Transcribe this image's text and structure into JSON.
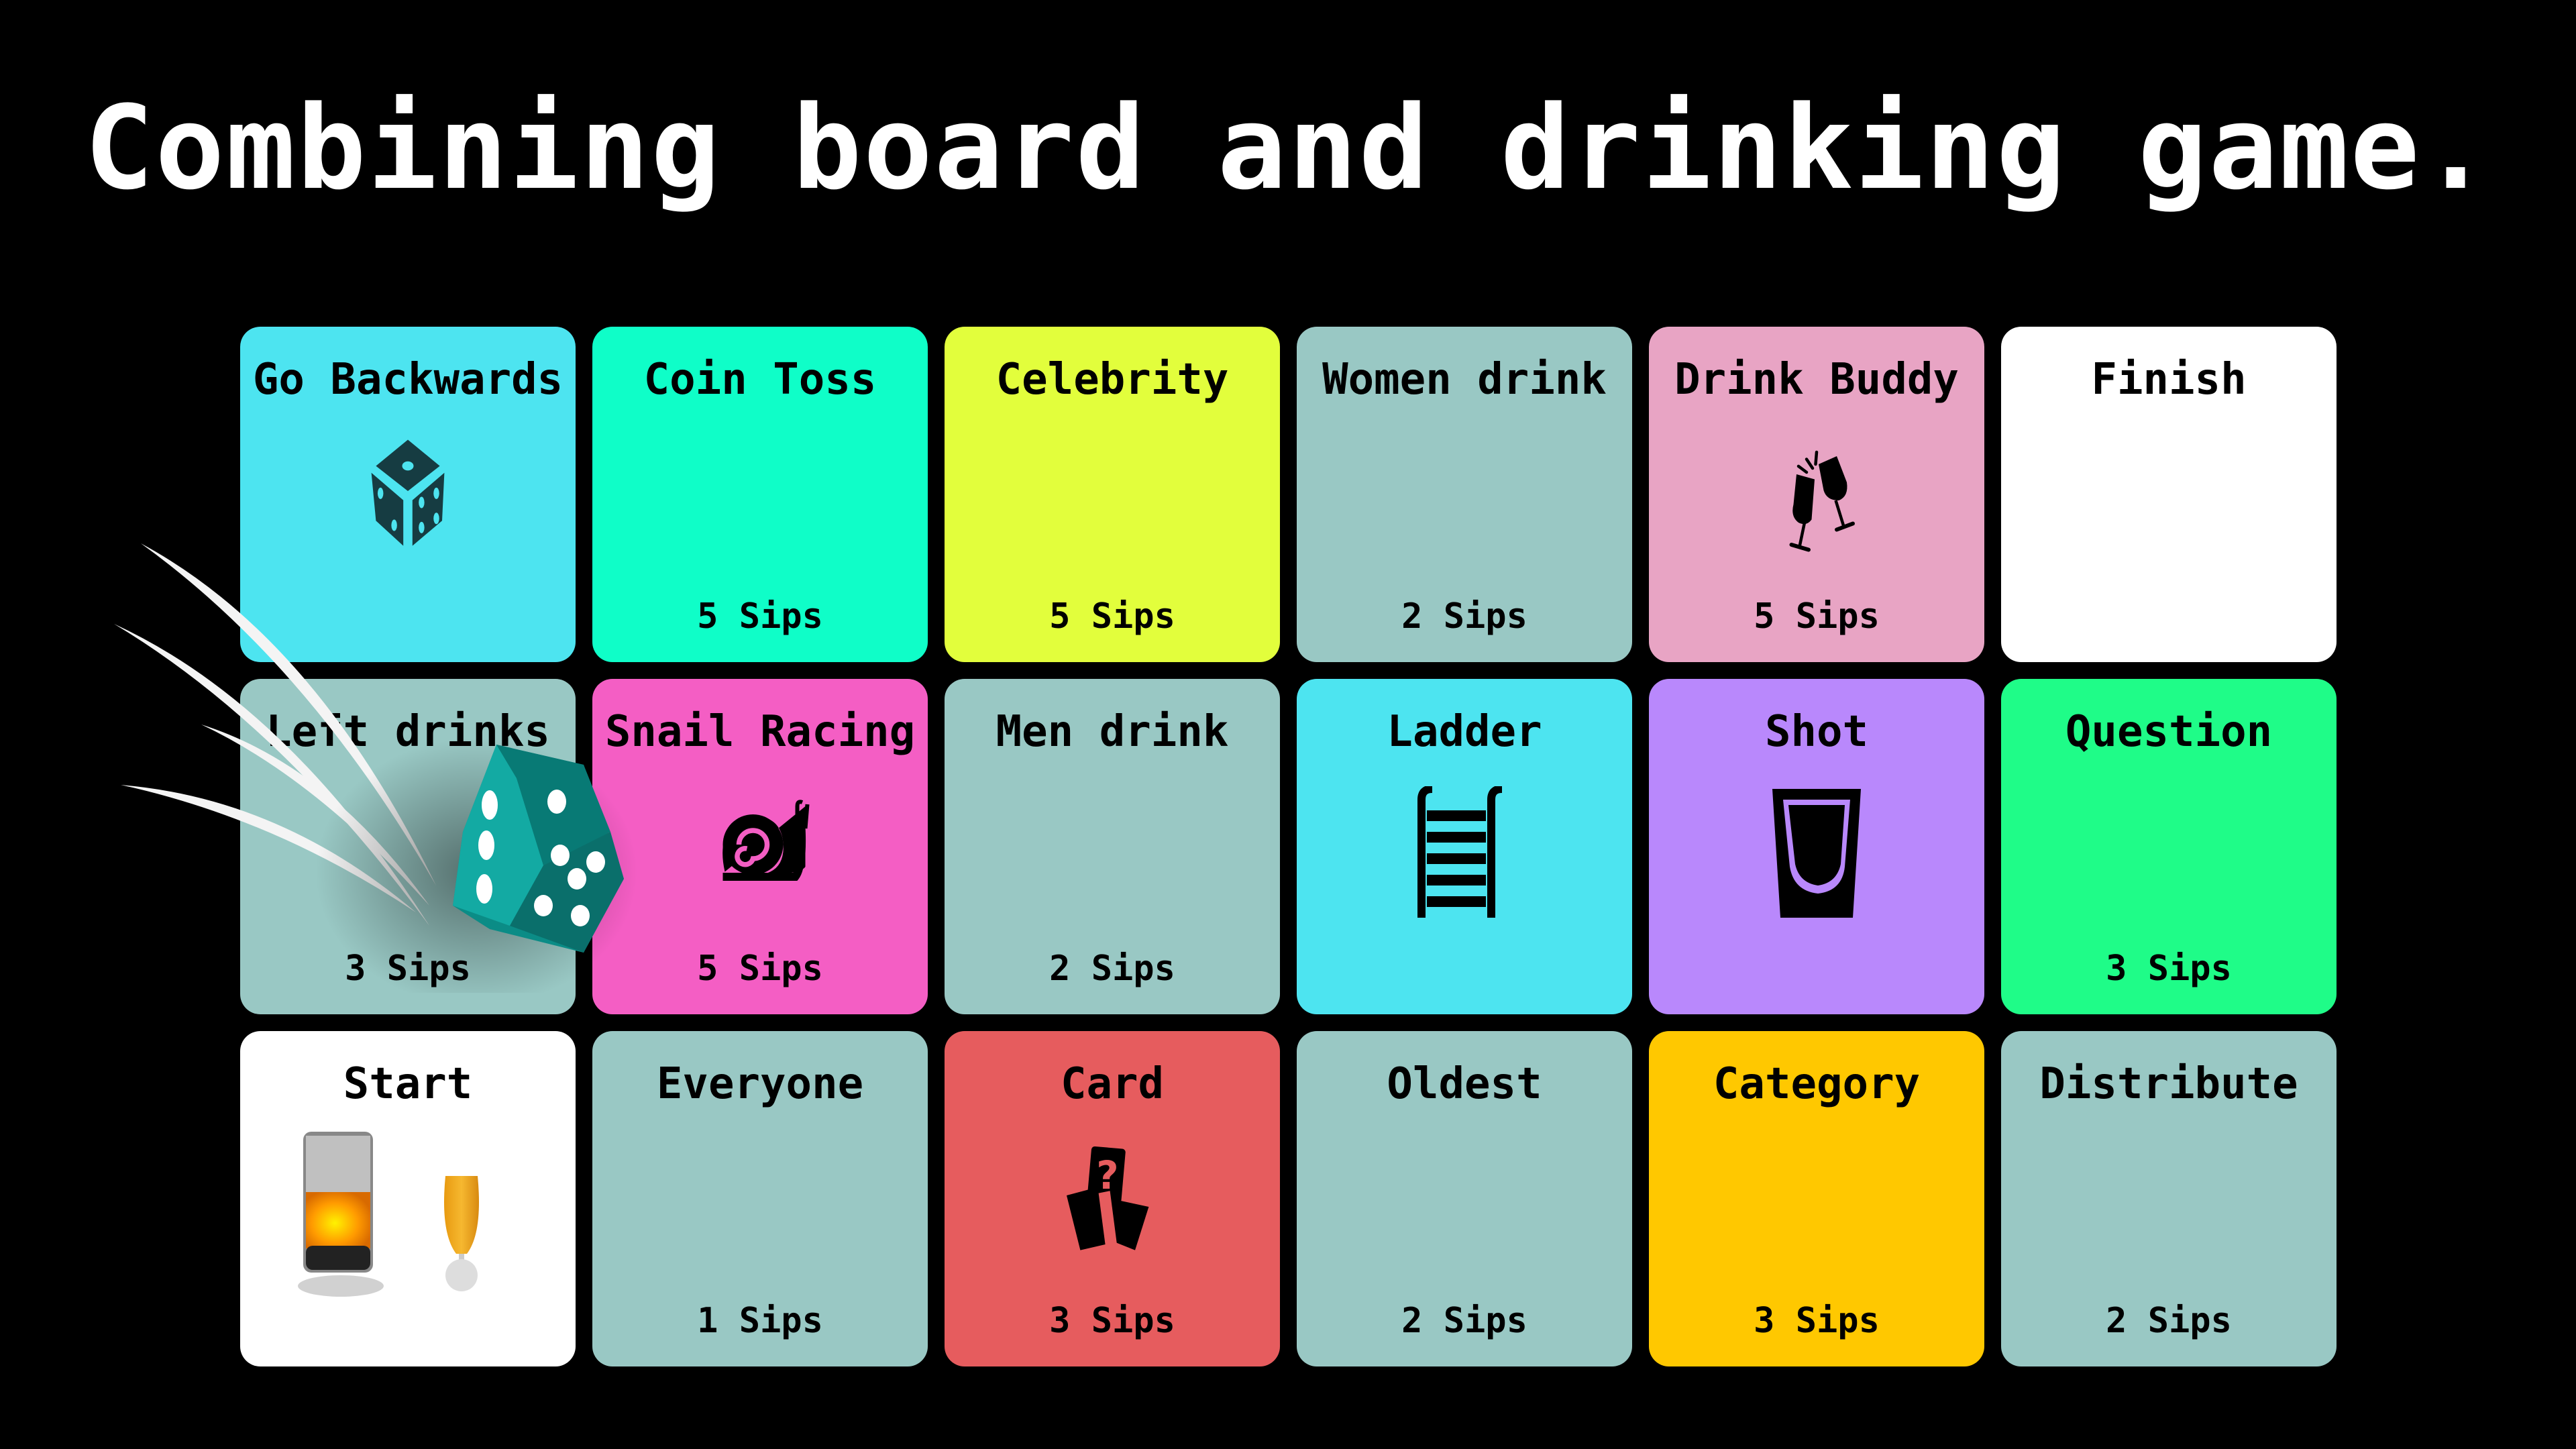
{
  "title": "Combining board and drinking game.",
  "tiles": [
    {
      "name": "Go Backwards",
      "sips": "",
      "color": "#4de4f0",
      "icon": "dice-icon"
    },
    {
      "name": "Coin Toss",
      "sips": "5 Sips",
      "color": "#0ffec8",
      "icon": ""
    },
    {
      "name": "Celebrity",
      "sips": "5 Sips",
      "color": "#e2fe3c",
      "icon": ""
    },
    {
      "name": "Women drink",
      "sips": "2 Sips",
      "color": "#99c8c4",
      "icon": ""
    },
    {
      "name": "Drink Buddy",
      "sips": "5 Sips",
      "color": "#e8a4c4",
      "icon": "champagne-toast-icon"
    },
    {
      "name": "Finish",
      "sips": "",
      "color": "#ffffff",
      "icon": ""
    },
    {
      "name": "Left drinks",
      "sips": "3 Sips",
      "color": "#99c8c4",
      "icon": ""
    },
    {
      "name": "Snail Racing",
      "sips": "5 Sips",
      "color": "#f45ec4",
      "icon": "snail-icon"
    },
    {
      "name": "Men drink",
      "sips": "2 Sips",
      "color": "#99c8c4",
      "icon": ""
    },
    {
      "name": "Ladder",
      "sips": "",
      "color": "#4de4f0",
      "icon": "ladder-icon"
    },
    {
      "name": "Shot",
      "sips": "",
      "color": "#b988fc",
      "icon": "shot-glass-icon"
    },
    {
      "name": "Question",
      "sips": "3 Sips",
      "color": "#1ffc88",
      "icon": ""
    },
    {
      "name": "Start",
      "sips": "",
      "color": "#ffffff",
      "icon": "drinks-icon"
    },
    {
      "name": "Everyone",
      "sips": "1 Sips",
      "color": "#99c8c4",
      "icon": ""
    },
    {
      "name": "Card",
      "sips": "3 Sips",
      "color": "#e65c5e",
      "icon": "cards-icon"
    },
    {
      "name": "Oldest",
      "sips": "2 Sips",
      "color": "#99c8c4",
      "icon": ""
    },
    {
      "name": "Category",
      "sips": "3 Sips",
      "color": "#ffc800",
      "icon": ""
    },
    {
      "name": "Distribute",
      "sips": "2 Sips",
      "color": "#99c8c4",
      "icon": ""
    }
  ],
  "dice_color": "#0e9e98"
}
